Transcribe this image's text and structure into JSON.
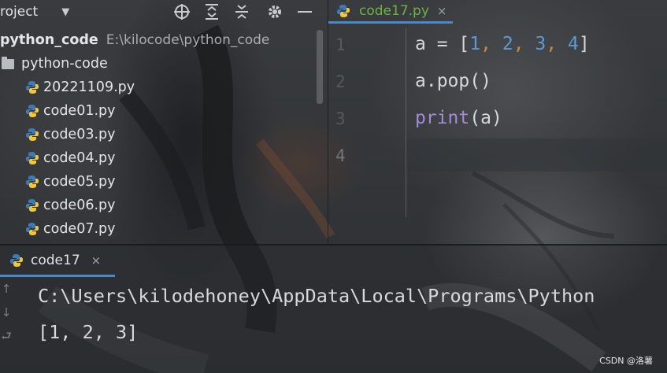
{
  "project_panel": {
    "title": "roject",
    "root": {
      "name": "python_code",
      "path": "E:\\kilocode\\python_code"
    },
    "folder": "python-code",
    "files": [
      "20221109.py",
      "code01.py",
      "code03.py",
      "code04.py",
      "code05.py",
      "code06.py",
      "code07.py"
    ]
  },
  "toolbar_icons": [
    "crosshair-icon",
    "expand-all-icon",
    "collapse-all-icon",
    "gear-icon",
    "minimize-icon"
  ],
  "editor": {
    "tab_label": "code17.py",
    "tab_close": "×",
    "line_numbers": [
      "1",
      "2",
      "3",
      "4"
    ],
    "lines": {
      "l1": {
        "var": "a",
        "op": " = ",
        "open": "[",
        "n1": "1",
        "c1": ", ",
        "n2": "2",
        "c2": ", ",
        "n3": "3",
        "c3": ", ",
        "n4": "4",
        "close": "]"
      },
      "l2": {
        "text": "a.pop()"
      },
      "l3": {
        "kw": "print",
        "rest": "(a)"
      }
    }
  },
  "run_panel": {
    "tab_label": "code17",
    "tab_close": "×",
    "controls": [
      "↑",
      "↓",
      "⮐"
    ],
    "output": [
      "C:\\Users\\kilodehoney\\AppData\\Local\\Programs\\Python",
      "[1, 2, 3]"
    ]
  },
  "watermark": "CSDN @洛薯",
  "colors": {
    "tab_label_green": "#6fb33f",
    "tab_underline": "#4a88c7",
    "number_blue": "#5b9bd5",
    "keyword_purple": "#a58bd6"
  }
}
